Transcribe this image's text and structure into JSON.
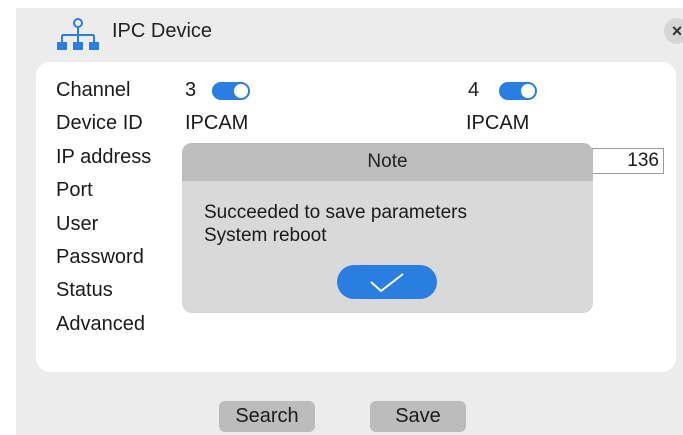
{
  "window": {
    "title": "IPC Device",
    "close_label": "×"
  },
  "form": {
    "labels": [
      "Channel",
      "Device ID",
      "IP address",
      "Port",
      "User",
      "Password",
      "Status",
      "Advanced"
    ],
    "columns": [
      {
        "channel": "3",
        "enabled": true,
        "device_id": "IPCAM"
      },
      {
        "channel": "4",
        "enabled": true,
        "device_id": "IPCAM",
        "ip_partial": "136"
      }
    ]
  },
  "modal": {
    "title": "Note",
    "line1": "Succeeded to save parameters",
    "line2": "System reboot",
    "ok_icon": "checkmark-icon"
  },
  "footer": {
    "search_label": "Search",
    "save_label": "Save"
  },
  "colors": {
    "accent": "#2a7de1",
    "dialog_bg": "#ececec",
    "modal_bg": "#d9d9d9",
    "button_bg": "#bcbcbc"
  },
  "icons": {
    "title": "network-tree-icon"
  }
}
